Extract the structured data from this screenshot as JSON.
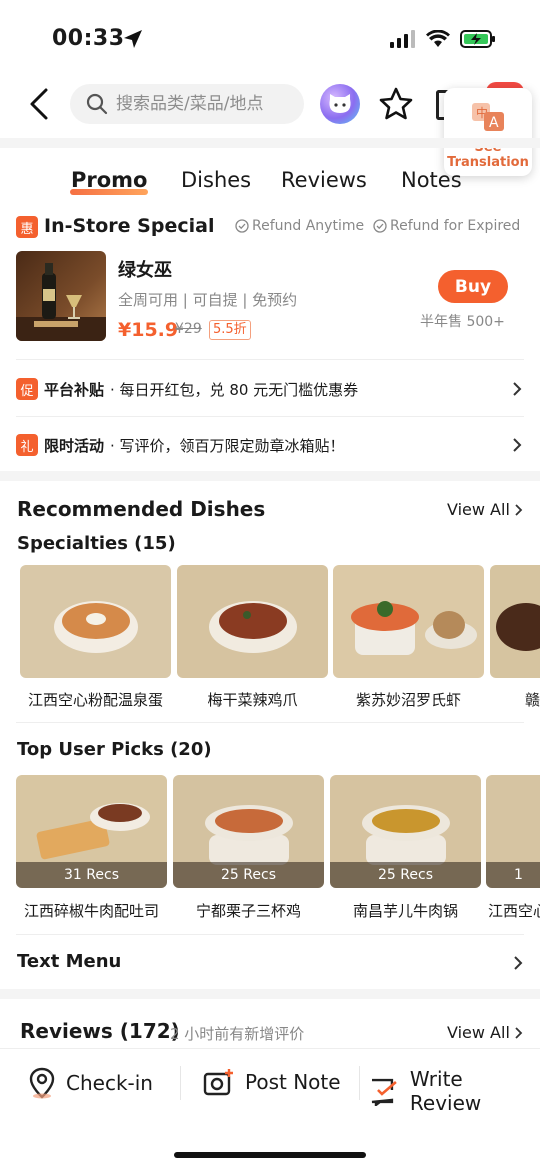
{
  "status": {
    "time": "00:33"
  },
  "search": {
    "placeholder": "搜索品类/菜品/地点"
  },
  "translate": {
    "label_line1": "See",
    "label_line2": "Translation"
  },
  "tabs": [
    {
      "label": "Promo"
    },
    {
      "label": "Dishes"
    },
    {
      "label": "Reviews"
    },
    {
      "label": "Notes"
    }
  ],
  "instore": {
    "tag": "惠",
    "title": "In-Store Special",
    "refund1": "Refund Anytime",
    "refund2": "Refund for Expired",
    "deal": {
      "name": "绿女巫",
      "desc": "全周可用 | 可自提 | 免预约",
      "price": "¥15.9",
      "orig_price": "¥29",
      "discount": "5.5折",
      "buy": "Buy",
      "sold": "半年售 500+"
    }
  },
  "promos": [
    {
      "tag": "促",
      "bold": "平台补贴",
      "text": "· 每日开红包，兑 80 元无门槛优惠券"
    },
    {
      "tag": "礼",
      "bold": "限时活动",
      "text": "· 写评价，领百万限定勋章冰箱贴！"
    }
  ],
  "recommended": {
    "title": "Recommended Dishes",
    "view_all": "View All",
    "specialties_title": "Specialties (15)",
    "specialties": [
      "江西空心粉配温泉蛋",
      "梅干菜辣鸡爪",
      "紫苏妙沼罗氏虾",
      "赣"
    ],
    "picks_title": "Top User Picks (20)",
    "picks": [
      {
        "name": "江西碎椒牛肉配吐司",
        "recs": "31 Recs"
      },
      {
        "name": "宁都栗子三杯鸡",
        "recs": "25 Recs"
      },
      {
        "name": "南昌芋儿牛肉锅",
        "recs": "25 Recs"
      },
      {
        "name": "江西空心",
        "recs": "1"
      }
    ]
  },
  "text_menu": "Text Menu",
  "reviews": {
    "title": "Reviews (172)",
    "subtitle": "2 小时前有新增评价",
    "view_all": "View All"
  },
  "bottom": {
    "checkin": "Check-in",
    "post_note": "Post Note",
    "write_review": "Write Review"
  },
  "colors": {
    "accent": "#f4602e",
    "grey_text": "#888888"
  }
}
